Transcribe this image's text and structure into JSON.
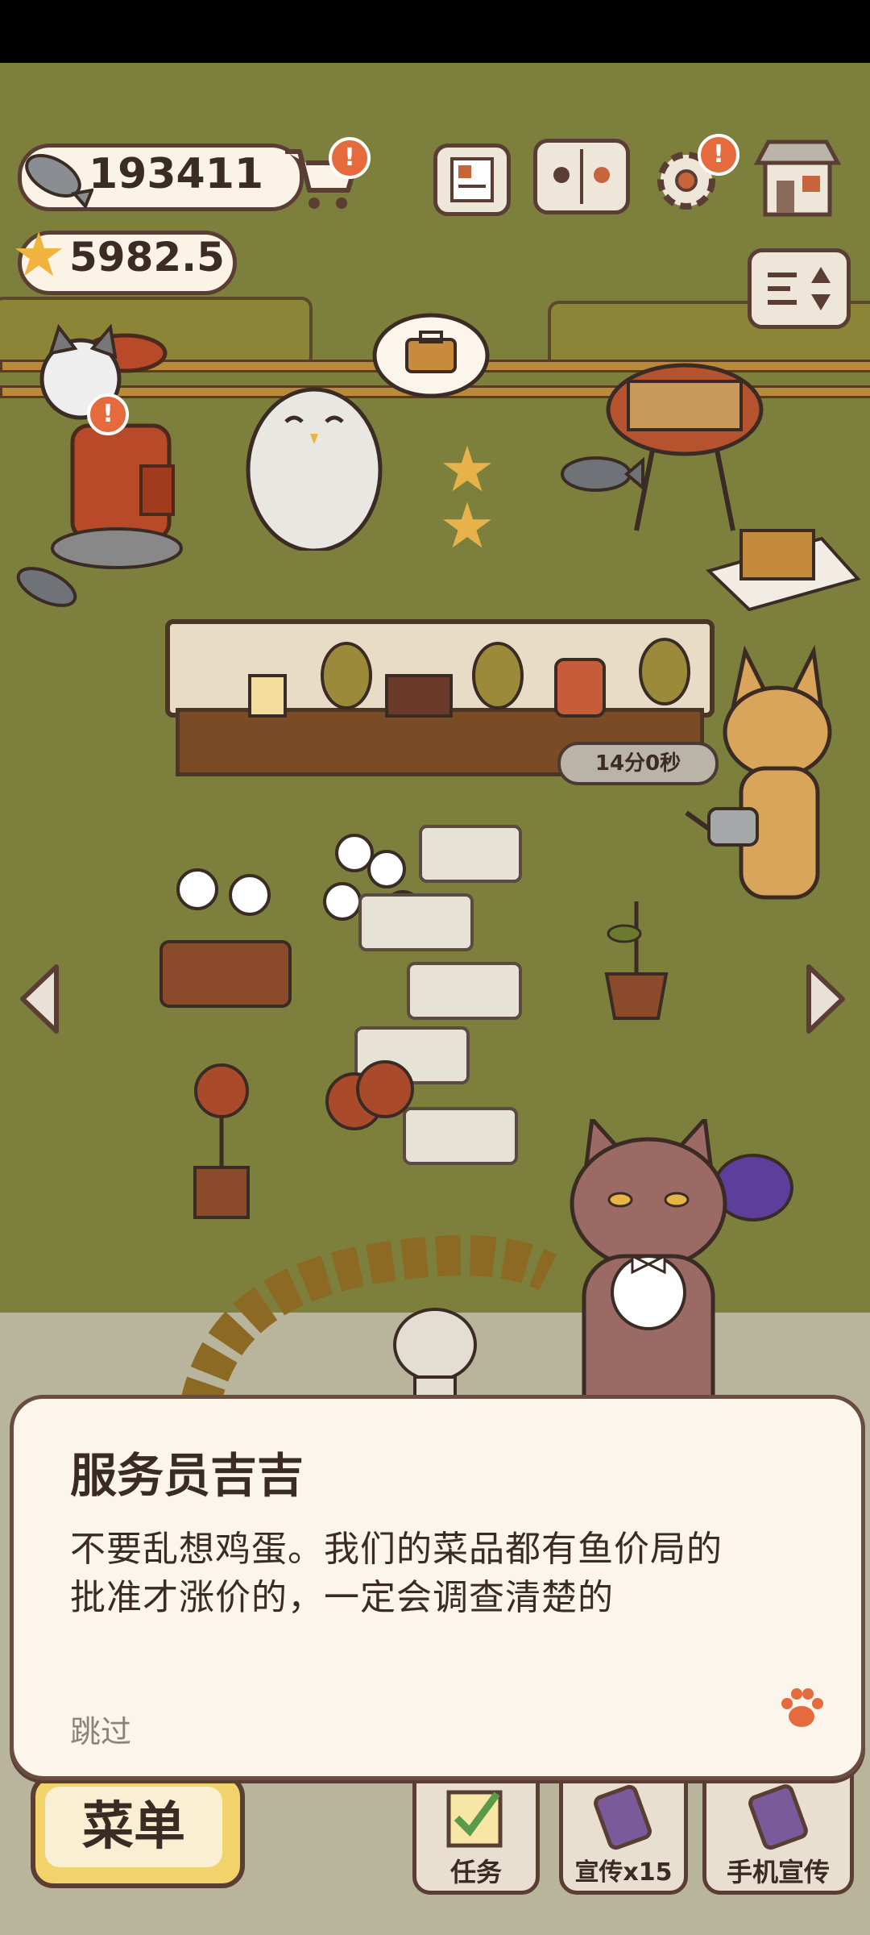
{
  "hud": {
    "fish_count": "193411",
    "star_count": "5982.5",
    "cart_badge": "!",
    "settings_badge": "!",
    "cat_badge": "!"
  },
  "timer": {
    "text": "14分0秒"
  },
  "dialog": {
    "speaker": "服务员吉吉",
    "line1": "不要乱想鸡蛋。我们的菜品都有鱼价局的",
    "line2": "批准才涨价的，一定会调查清楚的",
    "skip": "跳过"
  },
  "bottom_bar": {
    "menu": "菜单",
    "tasks": "任务",
    "promote": "宣传x15",
    "phone_promote": "手机宣传"
  },
  "colors": {
    "grass": "#7d7f3c",
    "accent": "#e56a3d",
    "panel": "#fbf5ec",
    "outline": "#5a3e34"
  }
}
